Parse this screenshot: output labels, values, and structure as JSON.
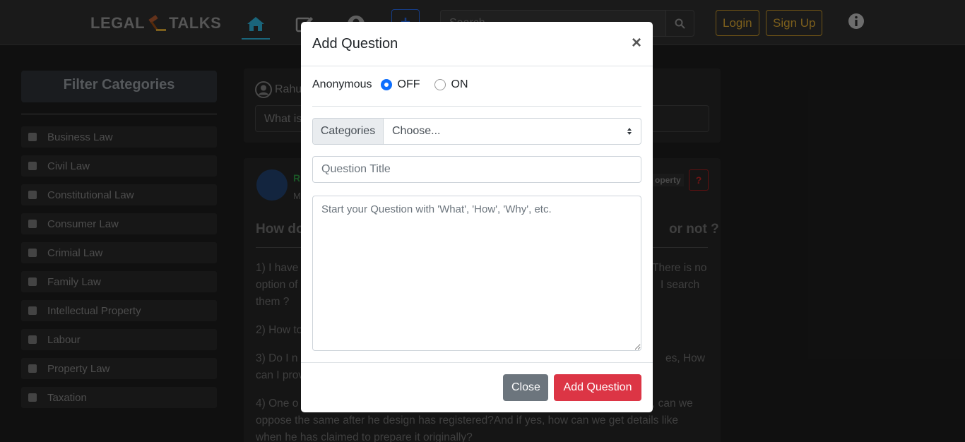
{
  "navbar": {
    "brand_left": "LEGAL",
    "brand_right": "TALKS",
    "icons": [
      "home-icon",
      "edit-icon",
      "user-icon",
      "plus-icon",
      "search-icon",
      "info-icon"
    ],
    "search_placeholder": "Search",
    "login_label": "Login",
    "signup_label": "Sign Up",
    "accent_color": "#c99a2e",
    "active_tab_color": "#2aa3c7"
  },
  "sidebar": {
    "title": "Filter Categories",
    "items": [
      "Business Law",
      "Civil Law",
      "Constitutional Law",
      "Consumer Law",
      "Crimial Law",
      "Family Law",
      "Intellectual Property",
      "Labour",
      "Property Law",
      "Taxation"
    ]
  },
  "ask_card": {
    "user": "Rahu",
    "input_text": "What is"
  },
  "question_card": {
    "name_fragment": "R",
    "sub_fragment": "M",
    "tag": "operty",
    "flag": "?",
    "title_left": "How do",
    "title_right": "or not ?",
    "lines": [
      {
        "left": "1) I have",
        "right": "There is no"
      },
      {
        "left": "option of",
        "right": "I search"
      },
      {
        "left": "them ?",
        "right": ""
      },
      {
        "left": "2) How to",
        "right": ""
      },
      {
        "left": "3) Do I n",
        "right": "es, How"
      },
      {
        "left": "can I prov",
        "right": ""
      },
      {
        "left": "4) One o",
        "right": ", can we"
      },
      {
        "left": "oppose the same after he design has registered?And if yes, how can we get details like",
        "right": ""
      },
      {
        "left": "when he has claimed to prepare it originally?",
        "right": ""
      }
    ]
  },
  "modal": {
    "title": "Add Question",
    "close_symbol": "×",
    "anonymous_label": "Anonymous",
    "options": [
      {
        "label": "OFF",
        "selected": true
      },
      {
        "label": "ON",
        "selected": false
      }
    ],
    "categories_label": "Categories",
    "categories_value": "Choose...",
    "title_placeholder": "Question Title",
    "body_placeholder": "Start your Question with 'What', 'How', 'Why', etc.",
    "close_button": "Close",
    "add_button": "Add Question",
    "primary_color": "#0d6efd",
    "danger_color": "#dc3545",
    "secondary_color": "#6c757d"
  }
}
